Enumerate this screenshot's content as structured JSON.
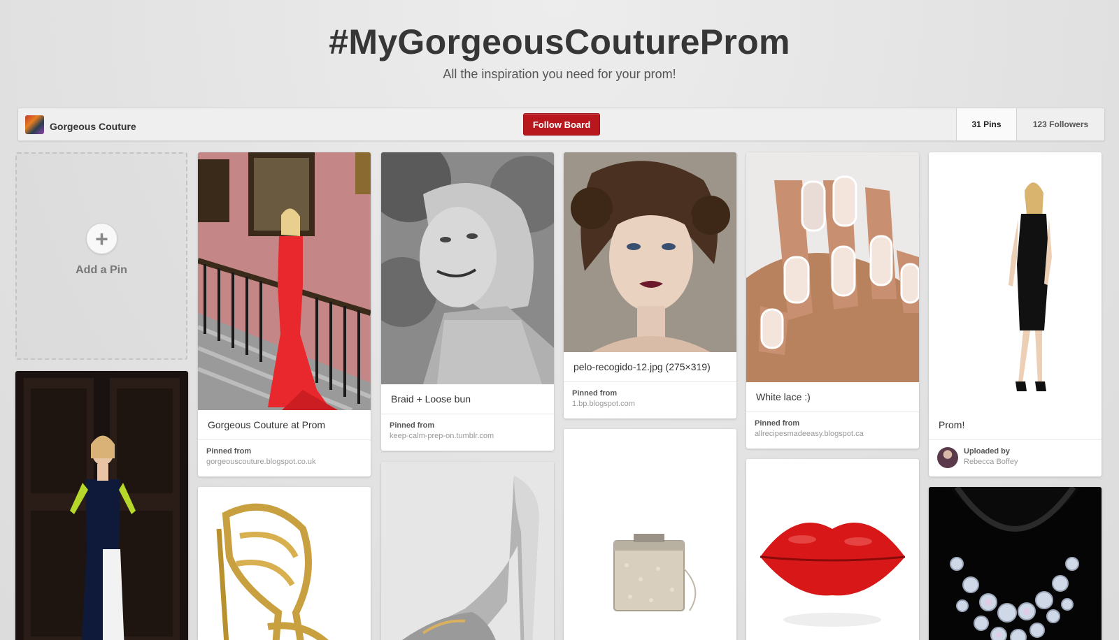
{
  "board": {
    "title": "#MyGorgeousCouturePro​m",
    "description": "All the inspiration you need for your prom!",
    "owner": "Gorgeous Couture",
    "follow_label": "Follow Board",
    "pins_count": "31 Pins",
    "followers_count": "123 Followers"
  },
  "add_pin": {
    "label": "Add a Pin",
    "icon": "plus-icon"
  },
  "pins": [
    {
      "caption": "Gorgeous Couture at Prom",
      "source_label": "Pinned from",
      "source": "gorgeouscouture.blogspot.co.uk"
    },
    {
      "caption": "Braid + Loose bun",
      "source_label": "Pinned from",
      "source": "keep-calm-prep-on.tumblr.com"
    },
    {
      "caption": "pelo-recogido-12.jpg (275×319)",
      "source_label": "Pinned from",
      "source": "1.bp.blogspot.com"
    },
    {
      "caption": "White lace :)",
      "source_label": "Pinned from",
      "source": "allrecipesmadeeasy.blogspot.ca"
    },
    {
      "caption": "Prom!",
      "source_label": "Uploaded by",
      "source": "Rebecca Boffey"
    }
  ],
  "colors": {
    "follow_button": "#b8181d",
    "background": "#e4e4e4"
  }
}
